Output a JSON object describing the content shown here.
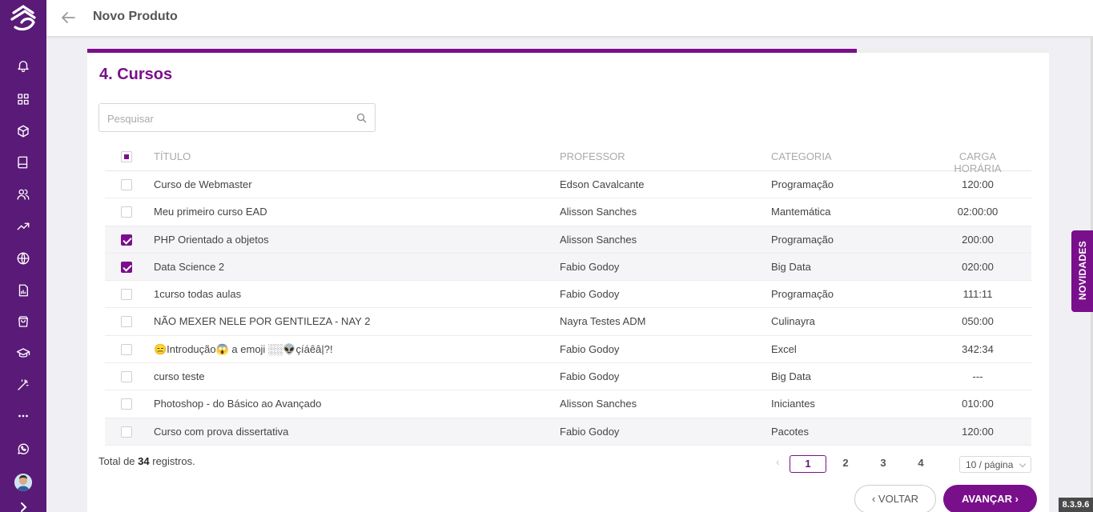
{
  "header": {
    "title": "Novo Produto"
  },
  "wizard": {
    "section_title": "4. Cursos",
    "progress": 0.8
  },
  "search": {
    "placeholder": "Pesquisar",
    "value": ""
  },
  "table": {
    "headers": {
      "title": "TÍTULO",
      "professor": "PROFESSOR",
      "category": "CATEGORIA",
      "hours": "CARGA HORÁRIA"
    },
    "rows": [
      {
        "title": "Curso de Webmaster",
        "professor": "Edson Cavalcante",
        "category": "Programação",
        "hours": "120:00",
        "checked": false
      },
      {
        "title": "Meu primeiro curso EAD",
        "professor": "Alisson Sanches",
        "category": "Mantemática",
        "hours": "02:00:00",
        "checked": false
      },
      {
        "title": "PHP Orientado a objetos",
        "professor": "Alisson Sanches",
        "category": "Programação",
        "hours": "200:00",
        "checked": true
      },
      {
        "title": "Data Science 2",
        "professor": "Fabio Godoy",
        "category": "Big Data",
        "hours": "020:00",
        "checked": true
      },
      {
        "title": "1curso todas aulas",
        "professor": "Fabio Godoy",
        "category": "Programação",
        "hours": "111:11",
        "checked": false
      },
      {
        "title": "NÃO MEXER NELE POR GENTILEZA - NAY 2",
        "professor": "Nayra Testes ADM",
        "category": "Culinayra",
        "hours": "050:00",
        "checked": false
      },
      {
        "title": "😑Introdução😱 a emoji ░░👽çíáêâ|?!",
        "professor": "Fabio Godoy",
        "category": "Excel",
        "hours": "342:34",
        "checked": false
      },
      {
        "title": "curso teste",
        "professor": "Fabio Godoy",
        "category": "Big Data",
        "hours": "---",
        "checked": false
      },
      {
        "title": "Photoshop - do Básico ao Avançado",
        "professor": "Alisson Sanches",
        "category": "Iniciantes",
        "hours": "010:00",
        "checked": false
      },
      {
        "title": "Curso com prova dissertativa",
        "professor": "Fabio Godoy",
        "category": "Pacotes",
        "hours": "120:00",
        "checked": false
      }
    ]
  },
  "footer": {
    "total_prefix": "Total de ",
    "total_count": "34",
    "total_suffix": " registros.",
    "pages": [
      "1",
      "2",
      "3",
      "4"
    ],
    "active_page": "1",
    "page_size": "10 / página",
    "back_label": "VOLTAR",
    "next_label": "AVANÇAR"
  },
  "novidades_label": "NOVIDADES",
  "version": "8.3.9.6",
  "colors": {
    "sidebar": "#5a1a78",
    "accent": "#7a0f8c"
  },
  "sidebar_icons": [
    "logo-icon",
    "bell-icon",
    "grid-icon",
    "box-icon",
    "book-icon",
    "users-icon",
    "trending-icon",
    "globe-icon",
    "report-icon",
    "shopping-bag-icon",
    "graduation-cap-icon",
    "magic-wand-icon",
    "more-icon",
    "whatsapp-icon",
    "avatar",
    "chevron-right-icon"
  ]
}
